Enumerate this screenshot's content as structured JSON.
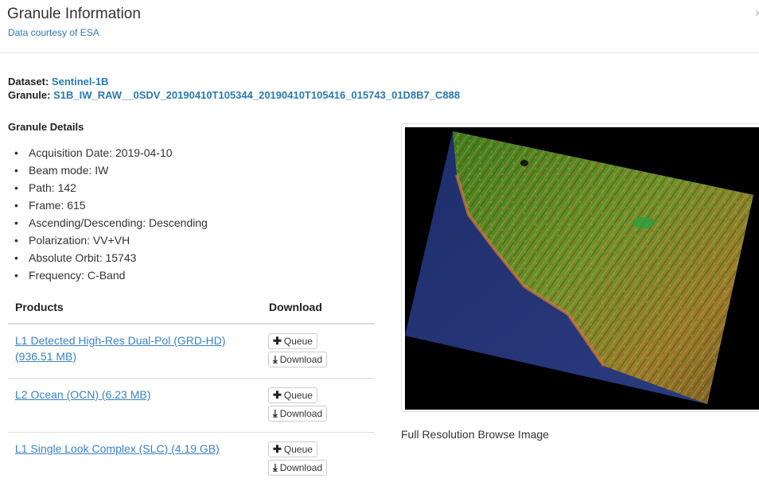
{
  "header": {
    "title": "Granule Information",
    "subtitle": "Data courtesy of ESA",
    "close": "x"
  },
  "dataset": {
    "label": "Dataset:",
    "value": "Sentinel-1B"
  },
  "granule": {
    "label": "Granule:",
    "value": "S1B_IW_RAW__0SDV_20190410T105344_20190410T105416_015743_01D8B7_C888"
  },
  "details": {
    "heading": "Granule Details",
    "items": [
      "Acquisition Date: 2019-04-10",
      "Beam mode: IW",
      "Path: 142",
      "Frame: 615",
      "Ascending/Descending: Descending",
      "Polarization: VV+VH",
      "Absolute Orbit: 15743",
      "Frequency: C-Band"
    ]
  },
  "products": {
    "col_products": "Products",
    "col_download": "Download",
    "queue_label": "Queue",
    "download_label": "Download",
    "rows": [
      {
        "name": "L1 Detected High-Res Dual-Pol (GRD-HD) (936.51 MB)"
      },
      {
        "name": "L2 Ocean (OCN) (6.23 MB)"
      },
      {
        "name": "L1 Single Look Complex (SLC) (4.19 GB)"
      }
    ]
  },
  "browse": {
    "caption": "Full Resolution Browse Image"
  },
  "icons": {
    "queue": "plus-icon",
    "download": "download-icon",
    "close": "close-icon"
  }
}
